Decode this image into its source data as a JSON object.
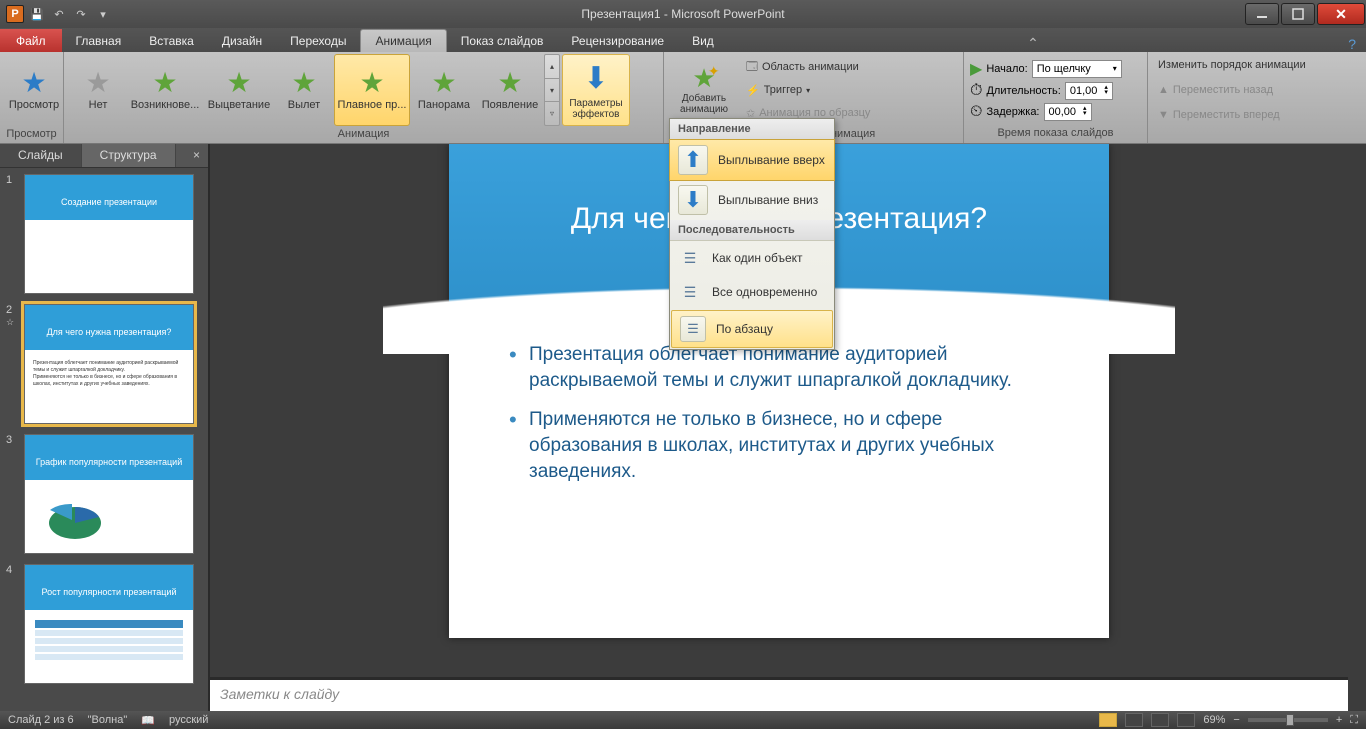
{
  "title": "Презентация1 - Microsoft PowerPoint",
  "qat": {
    "app_letter": "P"
  },
  "tabs": {
    "file": "Файл",
    "items": [
      "Главная",
      "Вставка",
      "Дизайн",
      "Переходы",
      "Анимация",
      "Показ слайдов",
      "Рецензирование",
      "Вид"
    ],
    "active_index": 4
  },
  "ribbon": {
    "preview": {
      "btn": "Просмотр",
      "group": "Просмотр"
    },
    "animation": {
      "group": "Анимация",
      "items": [
        "Нет",
        "Возникнове...",
        "Выцветание",
        "Вылет",
        "Плавное пр...",
        "Панорама",
        "Появление"
      ],
      "selected_index": 4,
      "effect_options": "Параметры эффектов"
    },
    "advanced": {
      "group": "Расширенная анимация",
      "add": "Добавить анимацию",
      "pane": "Область анимации",
      "trigger": "Триггер",
      "painter": "Анимация по образцу"
    },
    "timing": {
      "group": "Время показа слайдов",
      "start_label": "Начало:",
      "start_value": "По щелчку",
      "duration_label": "Длительность:",
      "duration_value": "01,00",
      "delay_label": "Задержка:",
      "delay_value": "00,00"
    },
    "reorder": {
      "title": "Изменить порядок анимации",
      "earlier": "Переместить назад",
      "later": "Переместить вперед"
    }
  },
  "dropdown": {
    "hdr1": "Направление",
    "opt1": "Выплывание вверх",
    "opt2": "Выплывание вниз",
    "hdr2": "Последовательность",
    "opt3": "Как один объект",
    "opt4": "Все одновременно",
    "opt5": "По абзацу"
  },
  "leftpanel": {
    "tabs": [
      "Слайды",
      "Структура"
    ],
    "thumbs": [
      {
        "n": "1",
        "title": "Создание презентации"
      },
      {
        "n": "2",
        "title": "Для чего нужна презентация?"
      },
      {
        "n": "3",
        "title": "График популярности презентаций"
      },
      {
        "n": "4",
        "title": "Рост популярности презентаций"
      }
    ]
  },
  "slide": {
    "title": "Для чего нужна презентация?",
    "title_left": "Для чего",
    "title_right": "резентация?",
    "bullets": [
      "Презентация облегчает понимание аудиторией раскрываемой темы и служит шпаргалкой докладчику.",
      "Применяются не только в бизнесе, но и сфере образования в школах, институтах и других учебных заведениях."
    ]
  },
  "notes": "Заметки к слайду",
  "status": {
    "slide": "Слайд 2 из 6",
    "theme": "\"Волна\"",
    "lang": "русский",
    "zoom": "69%"
  }
}
